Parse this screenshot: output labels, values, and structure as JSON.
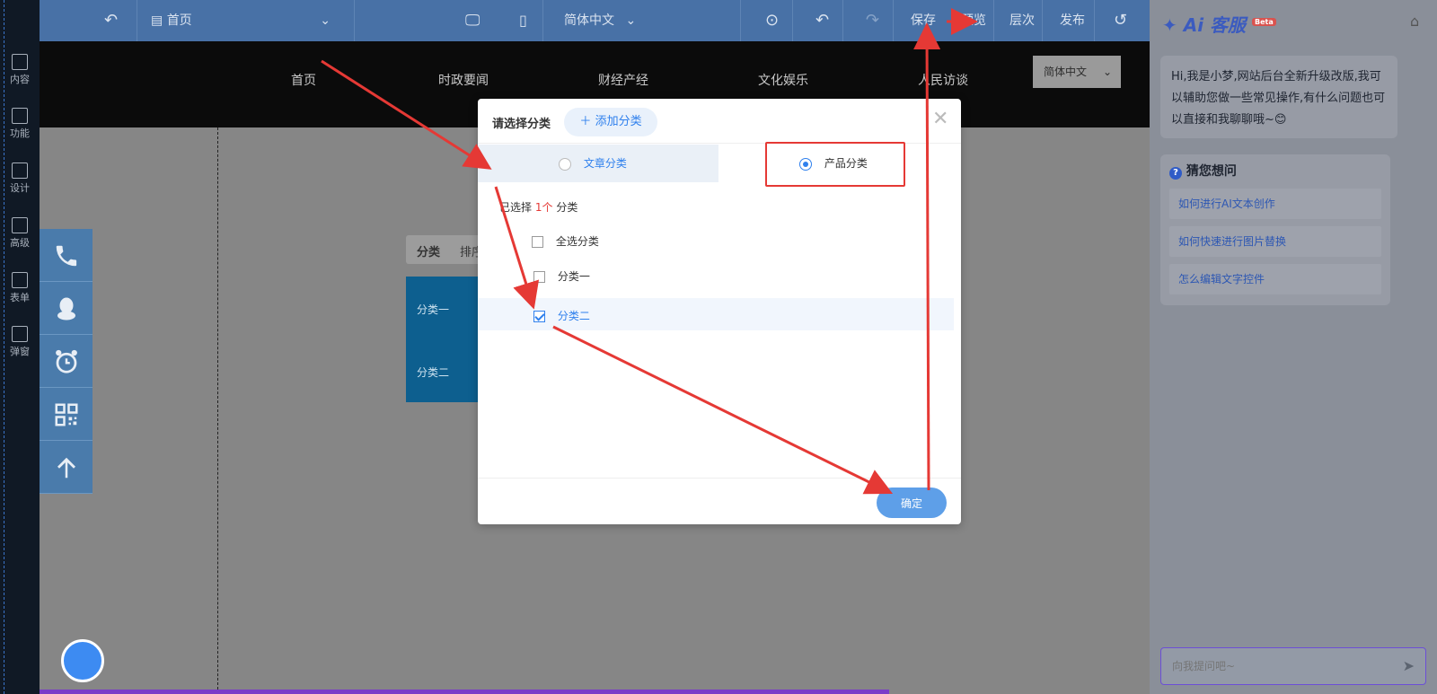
{
  "toolbar": {
    "page_select": "首页",
    "language": "简体中文",
    "save": "保存",
    "preview": "预览",
    "layers": "层次",
    "publish": "发布"
  },
  "left_rail": {
    "items": [
      {
        "label": "内容",
        "icon": "file-icon"
      },
      {
        "label": "功能",
        "icon": "grid-icon"
      },
      {
        "label": "设计",
        "icon": "layout-icon"
      },
      {
        "label": "高级",
        "icon": "code-icon"
      },
      {
        "label": "表单",
        "icon": "form-icon"
      },
      {
        "label": "弹窗",
        "icon": "popup-icon"
      }
    ]
  },
  "site": {
    "nav": [
      "首页",
      "时政要闻",
      "财经产经",
      "文化娱乐",
      "人民访谈"
    ],
    "language": "简体中文"
  },
  "widget": {
    "tab_active": "分类",
    "tab_other": "排序",
    "list": [
      "分类一",
      "分类二"
    ]
  },
  "modal": {
    "title": "请选择分类",
    "add_button": "添加分类",
    "tabs": [
      {
        "label": "文章分类",
        "selected": false
      },
      {
        "label": "产品分类",
        "selected": true
      }
    ],
    "selected_prefix": "已选择",
    "selected_count": "1个",
    "selected_suffix": "分类",
    "select_all": "全选分类",
    "options": [
      {
        "label": "分类一",
        "checked": false
      },
      {
        "label": "分类二",
        "checked": true
      }
    ],
    "confirm": "确定"
  },
  "ai_panel": {
    "brand": "Ai 客服",
    "badge": "Beta",
    "greeting": "Hi,我是小梦,网站后台全新升级改版,我可以辅助您做一些常见操作,有什么问题也可以直接和我聊聊哦~😊",
    "guess_title": "猜您想问",
    "suggestions": [
      "如何进行AI文本创作",
      "如何快速进行图片替换",
      "怎么编辑文字控件"
    ],
    "input_placeholder": "向我提问吧~"
  },
  "colors": {
    "toolbar": "#4871a6",
    "primary": "#2f80ed",
    "highlight": "#e53935",
    "count": "#e53935"
  }
}
